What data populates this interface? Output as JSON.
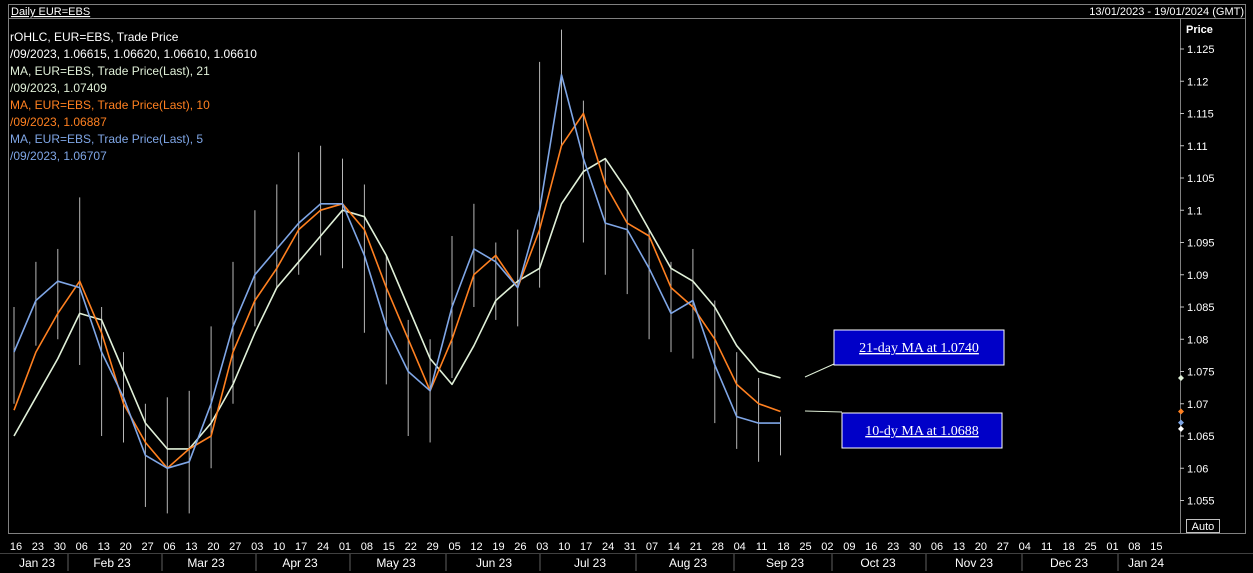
{
  "header": {
    "title": "Daily EUR=EBS",
    "date_range": "13/01/2023 - 19/01/2024 (GMT)"
  },
  "legend": {
    "ohlc_title": "rOHLC, EUR=EBS, Trade Price",
    "ohlc_values": "/09/2023, 1.06615, 1.06620, 1.06610, 1.06610",
    "ma21_title": "MA, EUR=EBS, Trade Price(Last),  21",
    "ma21_value": "/09/2023, 1.07409",
    "ma10_title": "MA, EUR=EBS, Trade Price(Last),  10",
    "ma10_value": "/09/2023, 1.06887",
    "ma5_title": "MA, EUR=EBS, Trade Price(Last),  5",
    "ma5_value": "/09/2023, 1.06707"
  },
  "axis": {
    "price_label": "Price",
    "auto_button": "Auto"
  },
  "callouts": {
    "ma21": "21-day MA at 1.0740",
    "ma10": "10-dy MA at 1.0688"
  },
  "colors": {
    "background": "#000000",
    "ohlc": "#d8d8d8",
    "ma21": "#e0f0d8",
    "ma10": "#ff8020",
    "ma5": "#7fa6e6",
    "callout_bg": "#0000c8"
  },
  "chart_data": {
    "type": "line",
    "title": "Daily EUR=EBS",
    "ylabel": "Price",
    "ylim": [
      1.05,
      1.125
    ],
    "yticks": [
      "1.125",
      "1.12",
      "1.115",
      "1.11",
      "1.105",
      "1.1",
      "1.095",
      "1.09",
      "1.085",
      "1.08",
      "1.075",
      "1.07",
      "1.065",
      "1.06",
      "1.055"
    ],
    "xtick_labels": [
      "16",
      "23",
      "30",
      "06",
      "13",
      "20",
      "27",
      "06",
      "13",
      "20",
      "27",
      "03",
      "10",
      "17",
      "24",
      "01",
      "08",
      "15",
      "22",
      "29",
      "05",
      "12",
      "19",
      "26",
      "03",
      "10",
      "17",
      "24",
      "31",
      "07",
      "14",
      "21",
      "28",
      "04",
      "11",
      "18",
      "25",
      "02",
      "09",
      "16",
      "23",
      "30",
      "06",
      "13",
      "20",
      "27",
      "04",
      "11",
      "18",
      "25",
      "01",
      "08",
      "15"
    ],
    "months": [
      "Jan 23",
      "Feb 23",
      "Mar 23",
      "Apr 23",
      "May 23",
      "Jun 23",
      "Jul 23",
      "Aug 23",
      "Sep 23",
      "Oct 23",
      "Nov 23",
      "Dec 23",
      "Jan 24"
    ],
    "series": [
      {
        "name": "MA, EUR=EBS, Trade Price(Last),  5",
        "week_index": [
          0,
          1,
          2,
          3,
          4,
          5,
          6,
          7,
          8,
          9,
          10,
          11,
          12,
          13,
          14,
          15,
          16,
          17,
          18,
          19,
          20,
          21,
          22,
          23,
          24,
          25,
          26,
          27,
          28,
          29,
          30,
          31,
          32,
          33,
          34,
          35
        ],
        "values": [
          1.078,
          1.086,
          1.089,
          1.088,
          1.078,
          1.071,
          1.062,
          1.06,
          1.061,
          1.07,
          1.082,
          1.09,
          1.094,
          1.098,
          1.101,
          1.101,
          1.093,
          1.082,
          1.075,
          1.072,
          1.085,
          1.094,
          1.092,
          1.088,
          1.1,
          1.121,
          1.108,
          1.098,
          1.097,
          1.091,
          1.084,
          1.086,
          1.076,
          1.068,
          1.067,
          1.067
        ]
      },
      {
        "name": "MA, EUR=EBS, Trade Price(Last),  10",
        "week_index": [
          0,
          1,
          2,
          3,
          4,
          5,
          6,
          7,
          8,
          9,
          10,
          11,
          12,
          13,
          14,
          15,
          16,
          17,
          18,
          19,
          20,
          21,
          22,
          23,
          24,
          25,
          26,
          27,
          28,
          29,
          30,
          31,
          32,
          33,
          34,
          35
        ],
        "values": [
          1.069,
          1.078,
          1.084,
          1.089,
          1.081,
          1.07,
          1.064,
          1.06,
          1.063,
          1.065,
          1.078,
          1.086,
          1.091,
          1.097,
          1.1,
          1.101,
          1.097,
          1.088,
          1.08,
          1.072,
          1.08,
          1.09,
          1.093,
          1.088,
          1.097,
          1.11,
          1.115,
          1.104,
          1.098,
          1.096,
          1.088,
          1.085,
          1.08,
          1.073,
          1.07,
          1.0688
        ]
      },
      {
        "name": "MA, EUR=EBS, Trade Price(Last),  21",
        "week_index": [
          0,
          1,
          2,
          3,
          4,
          5,
          6,
          7,
          8,
          9,
          10,
          11,
          12,
          13,
          14,
          15,
          16,
          17,
          18,
          19,
          20,
          21,
          22,
          23,
          24,
          25,
          26,
          27,
          28,
          29,
          30,
          31,
          32,
          33,
          34,
          35
        ],
        "values": [
          1.065,
          1.071,
          1.077,
          1.084,
          1.083,
          1.075,
          1.067,
          1.063,
          1.063,
          1.067,
          1.073,
          1.081,
          1.088,
          1.092,
          1.096,
          1.1,
          1.099,
          1.093,
          1.085,
          1.077,
          1.073,
          1.079,
          1.086,
          1.089,
          1.091,
          1.101,
          1.106,
          1.108,
          1.103,
          1.097,
          1.091,
          1.089,
          1.085,
          1.079,
          1.075,
          1.074
        ]
      }
    ],
    "ohlc_bars": [
      {
        "week_index": 0,
        "high": 1.085,
        "low": 1.07
      },
      {
        "week_index": 1,
        "high": 1.092,
        "low": 1.079
      },
      {
        "week_index": 2,
        "high": 1.094,
        "low": 1.08
      },
      {
        "week_index": 3,
        "high": 1.102,
        "low": 1.076
      },
      {
        "week_index": 4,
        "high": 1.085,
        "low": 1.065
      },
      {
        "week_index": 5,
        "high": 1.078,
        "low": 1.064
      },
      {
        "week_index": 6,
        "high": 1.07,
        "low": 1.054
      },
      {
        "week_index": 7,
        "high": 1.071,
        "low": 1.053
      },
      {
        "week_index": 8,
        "high": 1.072,
        "low": 1.053
      },
      {
        "week_index": 9,
        "high": 1.082,
        "low": 1.06
      },
      {
        "week_index": 10,
        "high": 1.092,
        "low": 1.07
      },
      {
        "week_index": 11,
        "high": 1.1,
        "low": 1.082
      },
      {
        "week_index": 12,
        "high": 1.104,
        "low": 1.088
      },
      {
        "week_index": 13,
        "high": 1.109,
        "low": 1.09
      },
      {
        "week_index": 14,
        "high": 1.11,
        "low": 1.093
      },
      {
        "week_index": 15,
        "high": 1.108,
        "low": 1.091
      },
      {
        "week_index": 16,
        "high": 1.104,
        "low": 1.081
      },
      {
        "week_index": 17,
        "high": 1.093,
        "low": 1.073
      },
      {
        "week_index": 18,
        "high": 1.083,
        "low": 1.065
      },
      {
        "week_index": 19,
        "high": 1.08,
        "low": 1.064
      },
      {
        "week_index": 20,
        "high": 1.096,
        "low": 1.074
      },
      {
        "week_index": 21,
        "high": 1.101,
        "low": 1.085
      },
      {
        "week_index": 22,
        "high": 1.095,
        "low": 1.083
      },
      {
        "week_index": 23,
        "high": 1.097,
        "low": 1.082
      },
      {
        "week_index": 24,
        "high": 1.123,
        "low": 1.088
      },
      {
        "week_index": 25,
        "high": 1.128,
        "low": 1.11
      },
      {
        "week_index": 26,
        "high": 1.117,
        "low": 1.095
      },
      {
        "week_index": 27,
        "high": 1.108,
        "low": 1.09
      },
      {
        "week_index": 28,
        "high": 1.103,
        "low": 1.087
      },
      {
        "week_index": 29,
        "high": 1.097,
        "low": 1.08
      },
      {
        "week_index": 30,
        "high": 1.092,
        "low": 1.078
      },
      {
        "week_index": 31,
        "high": 1.094,
        "low": 1.077
      },
      {
        "week_index": 32,
        "high": 1.086,
        "low": 1.067
      },
      {
        "week_index": 33,
        "high": 1.078,
        "low": 1.063
      },
      {
        "week_index": 34,
        "high": 1.074,
        "low": 1.061
      },
      {
        "week_index": 35,
        "high": 1.068,
        "low": 1.062
      }
    ],
    "last_values": {
      "ma21": 1.074,
      "ma10": 1.0688,
      "ma5": 1.06707,
      "close": 1.0661
    },
    "grid": false,
    "legend_placement": "top-left"
  }
}
